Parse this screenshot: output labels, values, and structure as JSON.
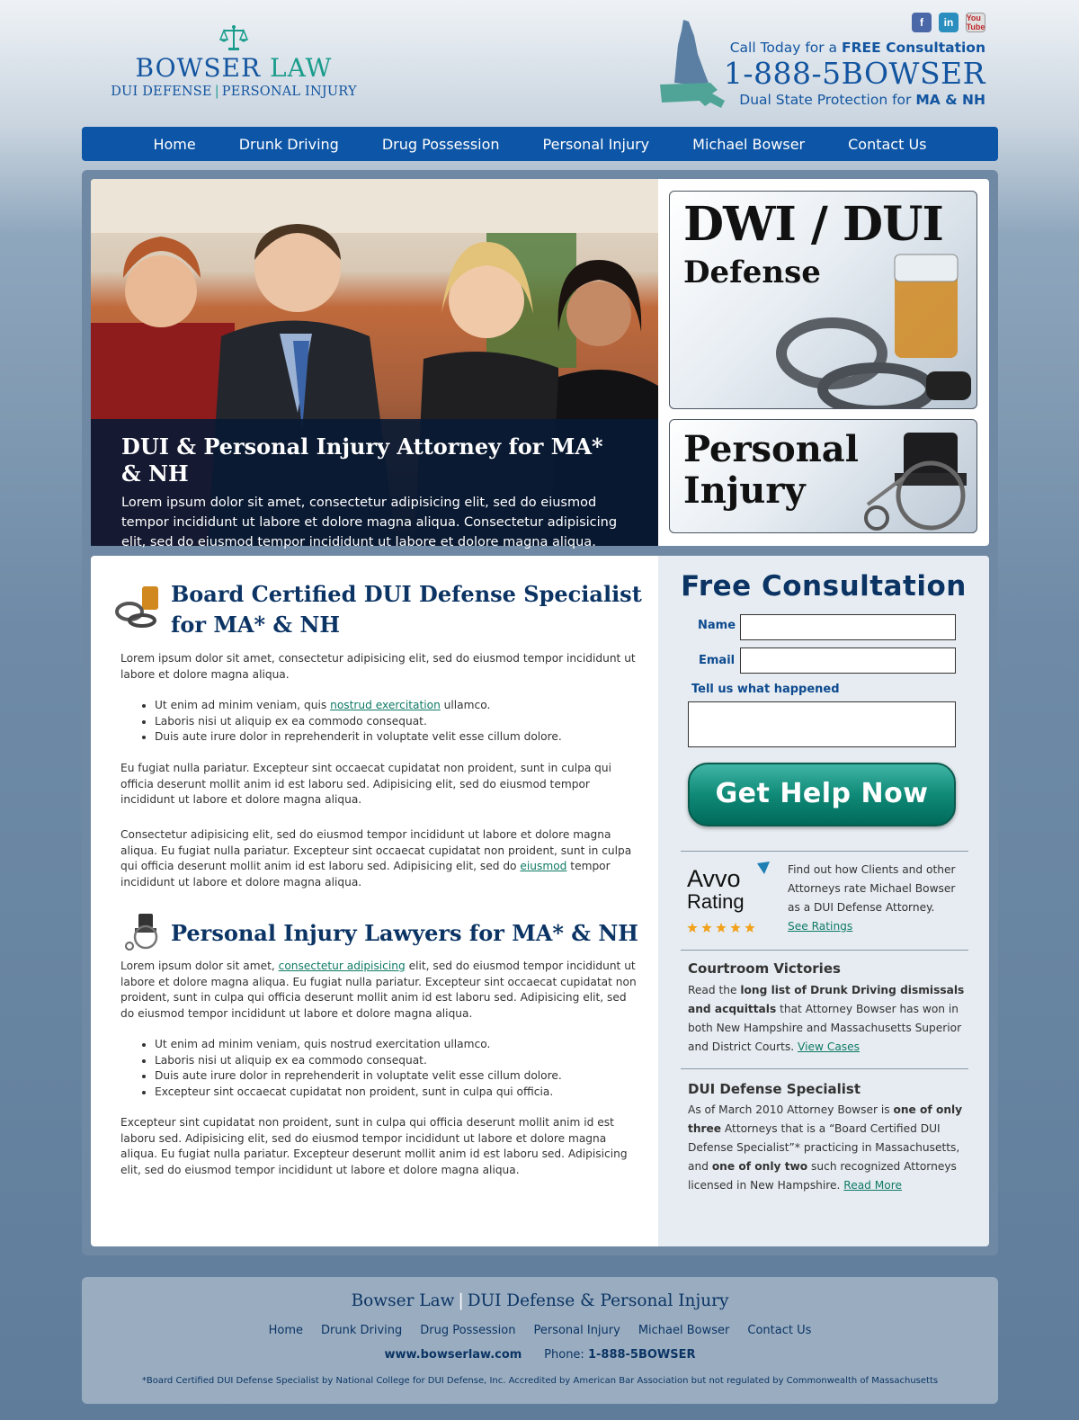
{
  "header": {
    "logo_name_a": "BOWSER",
    "logo_name_b": "LAW",
    "logo_tag_a": "DUI DEFENSE",
    "logo_tag_sep": "|",
    "logo_tag_b": "PERSONAL INJURY",
    "call_prefix": "Call Today for a ",
    "call_bold": "FREE Consultation",
    "phone": "1-888-5BOWSER",
    "dual_prefix": "Dual State Protection for ",
    "dual_bold": "MA & NH",
    "social": [
      "f",
      "in",
      "You Tube"
    ]
  },
  "nav": {
    "items": [
      "Home",
      "Drunk Driving",
      "Drug Possession",
      "Personal Injury",
      "Michael Bowser",
      "Contact Us"
    ]
  },
  "hero": {
    "title": "DUI & Personal Injury Attorney for MA* & NH",
    "text": "Lorem ipsum dolor sit amet, consectetur adipisicing elit, sed do eiusmod tempor incididunt ut labore et dolore magna aliqua. Consectetur adipisicing elit, sed do eiusmod tempor incididunt ut labore et dolore magna aliqua.",
    "promo_dwi_line1": "DWI / DUI",
    "promo_dwi_line2": "Defense",
    "promo_pi_line1": "Personal",
    "promo_pi_line2": "Injury"
  },
  "main": {
    "section1_title_a": "Board Certified DUI Defense Specialist",
    "section1_title_b": "for MA* & NH",
    "s1_p1": "Lorem ipsum dolor sit amet, consectetur adipisicing elit, sed do eiusmod tempor incididunt ut labore et dolore magna aliqua.",
    "s1_list": [
      {
        "before": "Ut enim ad minim veniam, quis ",
        "link": "nostrud exercitation",
        "after": " ullamco."
      },
      {
        "before": "Laboris nisi ut aliquip ex ea commodo consequat.",
        "link": "",
        "after": ""
      },
      {
        "before": "Duis aute irure dolor in reprehenderit in voluptate velit esse cillum dolore.",
        "link": "",
        "after": ""
      }
    ],
    "s1_p2": "Eu fugiat nulla pariatur. Excepteur sint occaecat cupidatat non proident, sunt in culpa qui officia deserunt mollit anim id est laboru sed. Adipisicing elit, sed do eiusmod tempor incididunt ut labore et dolore magna aliqua.",
    "s1_p3_before": "Consectetur adipisicing elit, sed do eiusmod tempor incididunt ut labore et dolore magna aliqua. Eu fugiat nulla pariatur. Excepteur sint occaecat cupidatat non proident, sunt in culpa qui officia deserunt mollit anim id est laboru sed. Adipisicing elit, sed do ",
    "s1_p3_link": "eiusmod",
    "s1_p3_after": " tempor incididunt ut labore et dolore magna aliqua.",
    "section2_title": "Personal Injury Lawyers for MA* & NH",
    "s2_p1_before": "Lorem ipsum dolor sit amet, ",
    "s2_p1_link": "consectetur adipisicing",
    "s2_p1_after": " elit, sed do eiusmod tempor incididunt ut labore et dolore magna aliqua. Eu fugiat nulla pariatur. Excepteur sint occaecat cupidatat non proident, sunt in culpa qui officia deserunt mollit anim id est laboru sed. Adipisicing elit, sed do eiusmod tempor incididunt ut labore et dolore magna aliqua.",
    "s2_list": [
      "Ut enim ad minim veniam, quis nostrud exercitation ullamco.",
      "Laboris nisi ut aliquip ex ea commodo consequat.",
      "Duis aute irure dolor in reprehenderit in voluptate velit esse cillum dolore.",
      "Excepteur sint occaecat cupidatat non proident, sunt in culpa qui officia."
    ],
    "s2_p2": "Excepteur sint cupidatat non proident, sunt in culpa qui officia deserunt mollit anim id est laboru sed. Adipisicing elit, sed do eiusmod tempor incididunt ut labore et dolore magna aliqua. Eu fugiat nulla pariatur. Excepteur deserunt mollit anim id est laboru sed. Adipisicing elit, sed do eiusmod tempor incididunt ut labore et dolore magna aliqua."
  },
  "sidebar": {
    "form_title": "Free Consultation",
    "name_label": "Name",
    "email_label": "Email",
    "message_label": "Tell us what happened",
    "name_value": "",
    "email_value": "",
    "message_value": "",
    "submit_label": "Get Help Now",
    "avvo_logo_a": "Avvo",
    "avvo_logo_b": "Rating",
    "avvo_stars": 5,
    "avvo_text": "Find out how Clients and other Attorneys rate Michael Bowser as a DUI Defense Attorney.",
    "avvo_link": "See Ratings",
    "victories_title": "Courtroom Victories",
    "victories_before": "Read the ",
    "victories_bold": "long list of Drunk Driving dismissals and acquittals",
    "victories_after": " that Attorney Bowser has won in both New Hampshire and Massachusetts Superior and District Courts. ",
    "victories_link": "View Cases",
    "specialist_title": "DUI Defense Specialist",
    "spec_1": "As of March 2010 Attorney Bowser is ",
    "spec_2": "one of only three",
    "spec_3": " Attorneys that is a “Board Certified DUI Defense Specialist”* practicing in Massachusetts, and ",
    "spec_4": "one of only two",
    "spec_5": " such recognized Attorneys licensed in New Hampshire. ",
    "spec_link": "Read More"
  },
  "footer": {
    "title_a": "Bowser Law",
    "title_sep": "|",
    "title_b": "DUI Defense & Personal Injury",
    "nav": [
      "Home",
      "Drunk Driving",
      "Drug Possession",
      "Personal Injury",
      "Michael Bowser",
      "Contact Us"
    ],
    "website": "www.bowserlaw.com",
    "phone_label": "Phone:",
    "phone": "1-888-5BOWSER",
    "note": "*Board Certified DUI Defense Specialist by National College for DUI Defense, Inc. Accredited by American Bar Association but not regulated by Commonwealth of Massachusetts"
  },
  "colors": {
    "brand_blue": "#1355a0",
    "brand_teal": "#1a9c8c",
    "nav_bg": "#0d55a6",
    "heading_navy": "#0b3464",
    "cta_green": "#108a78"
  }
}
